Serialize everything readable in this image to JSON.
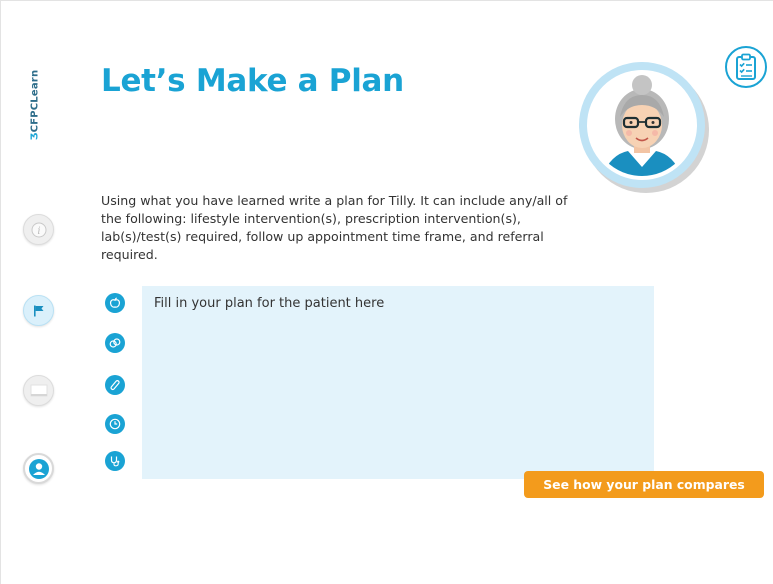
{
  "brand": {
    "mark": "Ʒ",
    "name": "CFPCLearn"
  },
  "page": {
    "title": "Let’s Make a Plan"
  },
  "intro_text": "Using what you have learned write a plan for Tilly. It can include any/all of the following: lifestyle intervention(s), prescription intervention(s), lab(s)/test(s) required, follow up appointment time frame, and referral required.",
  "sidebar": {
    "items": [
      {
        "icon": "info-icon",
        "active": false
      },
      {
        "icon": "flag-icon",
        "active": true
      },
      {
        "icon": "chat-icon",
        "active": false
      },
      {
        "icon": "user-icon",
        "active": false
      }
    ]
  },
  "plan_categories": [
    {
      "icon": "lifestyle-apple-icon"
    },
    {
      "icon": "prescription-pills-icon"
    },
    {
      "icon": "lab-test-tube-icon"
    },
    {
      "icon": "follow-up-clock-icon"
    },
    {
      "icon": "referral-stethoscope-icon"
    }
  ],
  "plan_input": {
    "placeholder": "Fill in your plan for the patient here",
    "value": ""
  },
  "compare_button": {
    "label": "See how your plan compares"
  },
  "colors": {
    "accent": "#1aa3d4",
    "button": "#f39b1c",
    "input_bg": "#e3f3fb"
  }
}
